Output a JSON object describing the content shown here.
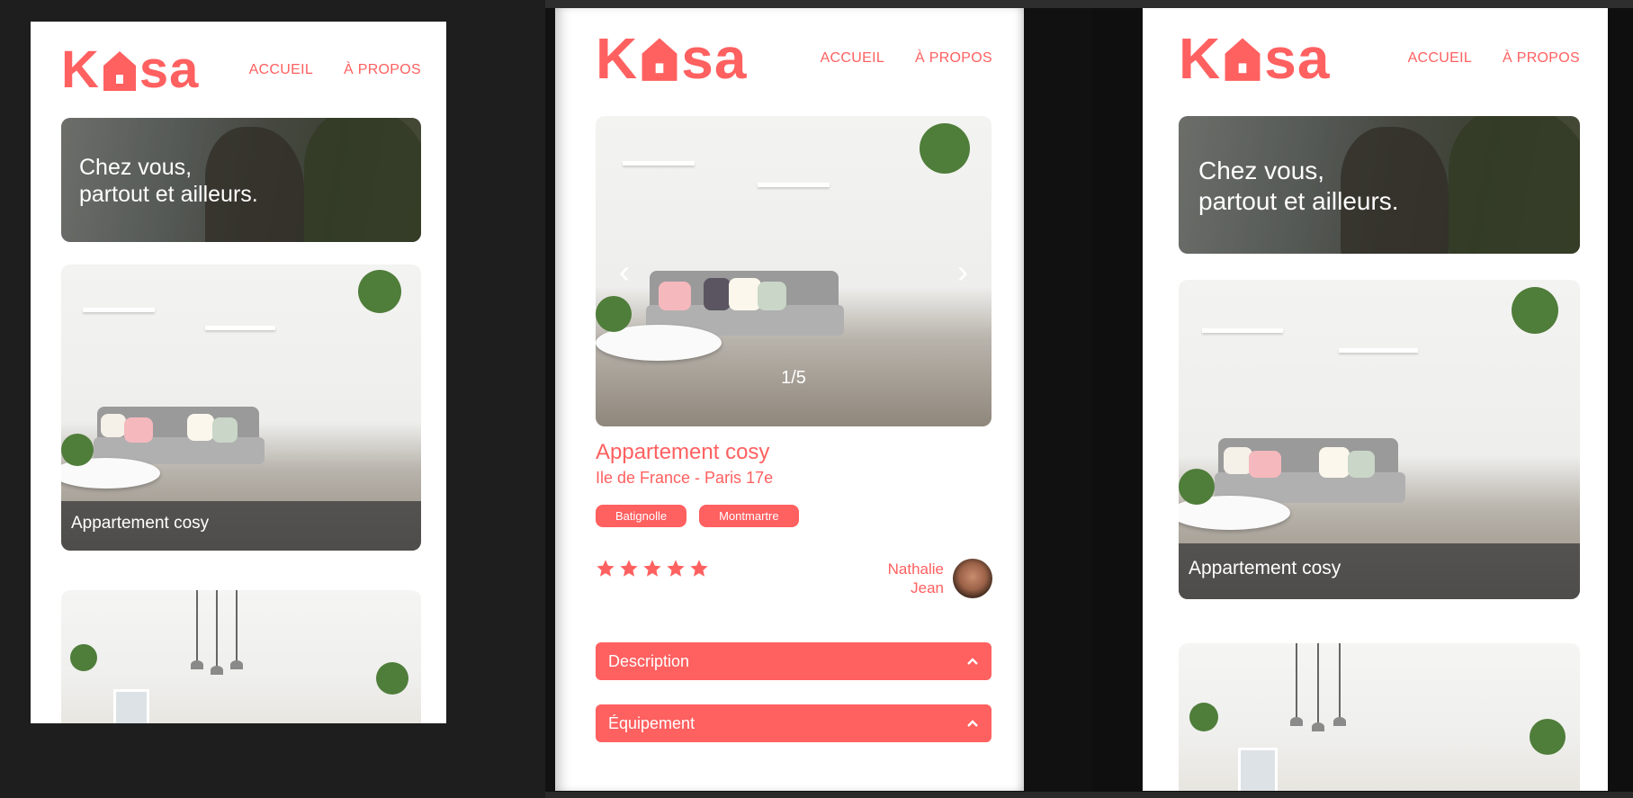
{
  "app": {
    "logo_prefix": "K",
    "logo_suffix": "sa",
    "nav": {
      "home": "ACCUEIL",
      "about": "À PROPOS"
    }
  },
  "home": {
    "banner_line1": "Chez vous,",
    "banner_line2": "partout et ailleurs.",
    "cards": [
      {
        "title": "Appartement cosy"
      }
    ]
  },
  "listing": {
    "title": "Appartement cosy",
    "location": "Ile de France - Paris 17e",
    "tags": [
      "Batignolle",
      "Montmartre"
    ],
    "rating": 5,
    "rating_max": 5,
    "host_first": "Nathalie",
    "host_last": "Jean",
    "gallery_counter": "1/5",
    "description_label": "Description",
    "equipment_label": "Équipement"
  },
  "colors": {
    "brand": "#ff6060",
    "caption_overlay": "#3c3c3c"
  }
}
